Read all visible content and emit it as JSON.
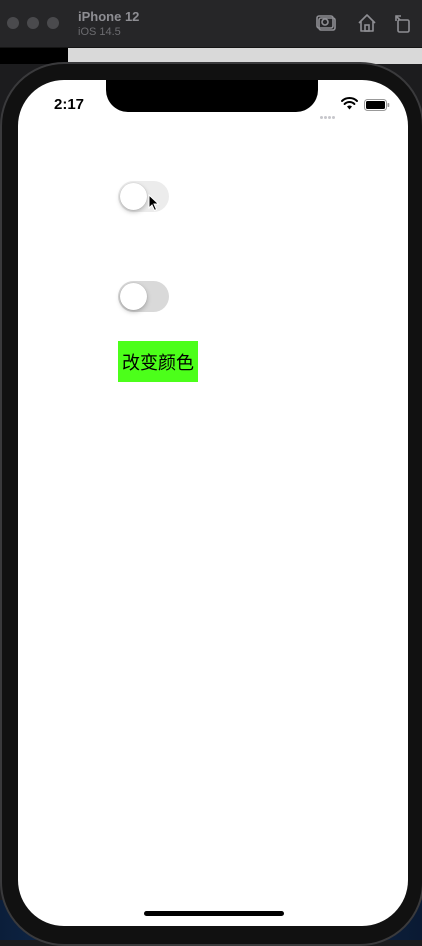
{
  "simulator": {
    "device_name": "iPhone 12",
    "os_version": "iOS 14.5"
  },
  "status_bar": {
    "time": "2:17"
  },
  "switches": [
    {
      "id": "switch-1",
      "on": false
    },
    {
      "id": "switch-2",
      "on": false
    }
  ],
  "color_button": {
    "label": "改变颜色",
    "background": "#4cff1a"
  }
}
